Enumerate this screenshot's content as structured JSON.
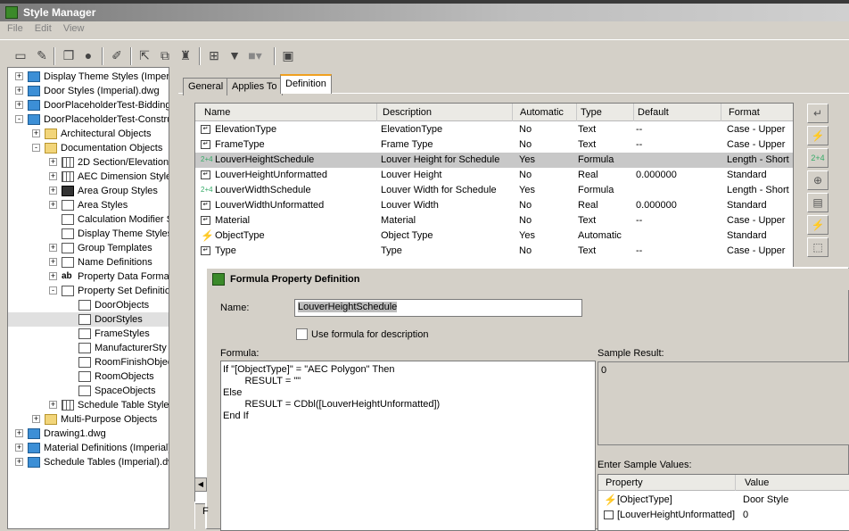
{
  "window": {
    "title": "Style Manager"
  },
  "menu": [
    "File",
    "Edit",
    "View"
  ],
  "tree": [
    {
      "label": "Display Theme Styles (Imperi",
      "exp": "+",
      "icon": "dwg"
    },
    {
      "label": "Door Styles (Imperial).dwg",
      "exp": "+",
      "icon": "dwg"
    },
    {
      "label": "DoorPlaceholderTest-Bidding",
      "exp": "+",
      "icon": "dwg"
    },
    {
      "label": "DoorPlaceholderTest-Constru",
      "exp": "-",
      "icon": "dwg"
    },
    {
      "label": "Architectural Objects",
      "exp": "+",
      "icon": "folder"
    },
    {
      "label": "Documentation Objects",
      "exp": "-",
      "icon": "folder"
    },
    {
      "label": "2D Section/Elevation",
      "exp": "+",
      "icon": "grid"
    },
    {
      "label": "AEC Dimension Styles",
      "exp": "+",
      "icon": "grid"
    },
    {
      "label": "Area Group Styles",
      "exp": "+",
      "icon": "dark"
    },
    {
      "label": "Area Styles",
      "exp": "+",
      "icon": "doc"
    },
    {
      "label": "Calculation Modifier S",
      "exp": "",
      "icon": "doc"
    },
    {
      "label": "Display Theme Styles",
      "exp": "",
      "icon": "doc"
    },
    {
      "label": "Group Templates",
      "exp": "+",
      "icon": "doc"
    },
    {
      "label": "Name Definitions",
      "exp": "+",
      "icon": "doc"
    },
    {
      "label": "Property Data Forma",
      "exp": "+",
      "icon": "ab"
    },
    {
      "label": "Property Set Definitio",
      "exp": "-",
      "icon": "doc"
    },
    {
      "label": "DoorObjects",
      "exp": "",
      "icon": "doc"
    },
    {
      "label": "DoorStyles",
      "exp": "",
      "icon": "doc"
    },
    {
      "label": "FrameStyles",
      "exp": "",
      "icon": "doc"
    },
    {
      "label": "ManufacturerSty",
      "exp": "",
      "icon": "doc"
    },
    {
      "label": "RoomFinishObjec",
      "exp": "",
      "icon": "doc"
    },
    {
      "label": "RoomObjects",
      "exp": "",
      "icon": "doc"
    },
    {
      "label": "SpaceObjects",
      "exp": "",
      "icon": "doc"
    },
    {
      "label": "Schedule Table Style",
      "exp": "+",
      "icon": "grid"
    },
    {
      "label": "Multi-Purpose Objects",
      "exp": "+",
      "icon": "folder"
    },
    {
      "label": "Drawing1.dwg",
      "exp": "+",
      "icon": "dwg"
    },
    {
      "label": "Material Definitions (Imperial)",
      "exp": "+",
      "icon": "dwg"
    },
    {
      "label": "Schedule Tables (Imperial).dw",
      "exp": "+",
      "icon": "dwg"
    }
  ],
  "tabs": {
    "general": "General",
    "applies_to": "Applies To",
    "definition": "Definition"
  },
  "list": {
    "columns": [
      "Name",
      "Description",
      "Automatic",
      "Type",
      "Default",
      "Format"
    ],
    "rows": [
      {
        "icon": "doc",
        "name": "ElevationType",
        "description": "ElevationType",
        "automatic": "No",
        "type": "Text",
        "default": "--",
        "format": "Case - Upper"
      },
      {
        "icon": "doc",
        "name": "FrameType",
        "description": "Frame Type",
        "automatic": "No",
        "type": "Text",
        "default": "--",
        "format": "Case - Upper"
      },
      {
        "icon": "formula",
        "name": "LouverHeightSchedule",
        "description": "Louver Height for Schedule",
        "automatic": "Yes",
        "type": "Formula",
        "default": "",
        "format": "Length - Short"
      },
      {
        "icon": "doc",
        "name": "LouverHeightUnformatted",
        "description": "Louver Height",
        "automatic": "No",
        "type": "Real",
        "default": "0.000000",
        "format": "Standard"
      },
      {
        "icon": "formula",
        "name": "LouverWidthSchedule",
        "description": "Louver Width for Schedule",
        "automatic": "Yes",
        "type": "Formula",
        "default": "",
        "format": "Length - Short"
      },
      {
        "icon": "doc",
        "name": "LouverWidthUnformatted",
        "description": "Louver Width",
        "automatic": "No",
        "type": "Real",
        "default": "0.000000",
        "format": "Standard"
      },
      {
        "icon": "doc",
        "name": "Material",
        "description": "Material",
        "automatic": "No",
        "type": "Text",
        "default": "--",
        "format": "Case - Upper"
      },
      {
        "icon": "auto",
        "name": "ObjectType",
        "description": "Object Type",
        "automatic": "Yes",
        "type": "Automatic",
        "default": "",
        "format": "Standard"
      },
      {
        "icon": "doc",
        "name": "Type",
        "description": "Type",
        "automatic": "No",
        "type": "Text",
        "default": "--",
        "format": "Case - Upper"
      }
    ]
  },
  "dialog": {
    "title": "Formula Property Definition",
    "name_label": "Name:",
    "name_value": "LouverHeightSchedule",
    "use_formula_label": "Use formula for description",
    "formula_label": "Formula:",
    "formula_text": "If \"[ObjectType]\" = \"AEC Polygon\" Then\n        RESULT = \"\"\nElse\n        RESULT = CDbl([LouverHeightUnformatted])\nEnd If",
    "sample_result_label": "Sample Result:",
    "sample_result_value": "0",
    "enter_sample_label": "Enter Sample Values:",
    "sample_columns": [
      "Property",
      "Value"
    ],
    "sample_rows": [
      {
        "icon": "auto",
        "property": "[ObjectType]",
        "value": "Door Style"
      },
      {
        "icon": "doc",
        "property": "[LouverHeightUnformatted]",
        "value": "0"
      }
    ]
  },
  "bottom_fragment": "F"
}
